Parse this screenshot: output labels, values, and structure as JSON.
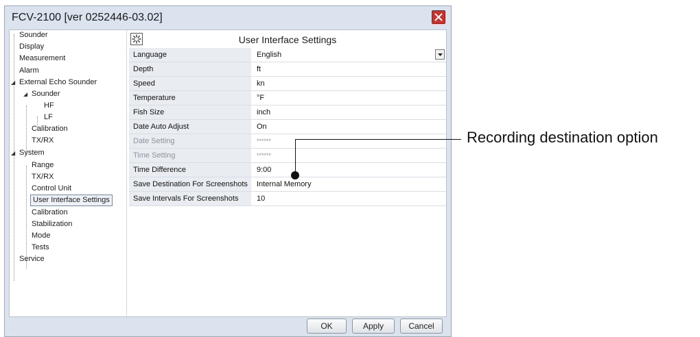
{
  "window": {
    "title": "FCV-2100 [ver 0252446-03.02]"
  },
  "tree": {
    "items": [
      {
        "label": "Sounder"
      },
      {
        "label": "Display"
      },
      {
        "label": "Measurement"
      },
      {
        "label": "Alarm"
      },
      {
        "label": "External Echo Sounder"
      },
      {
        "label": "Sounder"
      },
      {
        "label": "HF"
      },
      {
        "label": "LF"
      },
      {
        "label": "Calibration"
      },
      {
        "label": "TX/RX"
      },
      {
        "label": "System"
      },
      {
        "label": "Range"
      },
      {
        "label": "TX/RX"
      },
      {
        "label": "Control Unit"
      },
      {
        "label": "User Interface Settings"
      },
      {
        "label": "Calibration"
      },
      {
        "label": "Stabilization"
      },
      {
        "label": "Mode"
      },
      {
        "label": "Tests"
      },
      {
        "label": "Service"
      }
    ]
  },
  "panel": {
    "title": "User Interface Settings",
    "rows": [
      {
        "label": "Language",
        "value": "English"
      },
      {
        "label": "Depth",
        "value": "ft"
      },
      {
        "label": "Speed",
        "value": "kn"
      },
      {
        "label": "Temperature",
        "value": "°F"
      },
      {
        "label": "Fish Size",
        "value": "inch"
      },
      {
        "label": "Date Auto Adjust",
        "value": "On"
      },
      {
        "label": "Date Setting",
        "value": "******"
      },
      {
        "label": "Time Setting",
        "value": "******"
      },
      {
        "label": "Time Difference",
        "value": "9:00"
      },
      {
        "label": "Save Destination For Screenshots",
        "value": "Internal Memory"
      },
      {
        "label": "Save Intervals For Screenshots",
        "value": "10"
      }
    ]
  },
  "buttons": {
    "ok": "OK",
    "apply": "Apply",
    "cancel": "Cancel"
  },
  "callout": {
    "label": "Recording destination option"
  },
  "colors": {
    "window_bg": "#dbe3ee",
    "close": "#c8342d",
    "label_bg": "#e9ecf1"
  }
}
